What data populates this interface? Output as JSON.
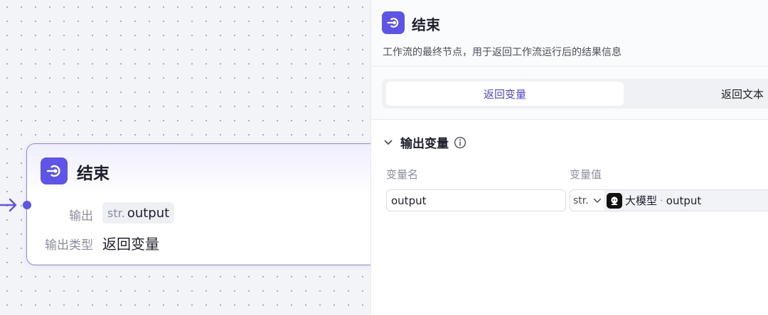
{
  "node": {
    "title": "结束",
    "output_label": "输出",
    "output_type_prefix": "str.",
    "output_name": "output",
    "output_type_label": "输出类型",
    "output_type_value": "返回变量"
  },
  "panel": {
    "title": "结束",
    "description": "工作流的最终节点，用于返回工作流运行后的结果信息",
    "tabs": [
      {
        "label": "返回变量",
        "active": true
      },
      {
        "label": "返回文本",
        "active": false
      }
    ],
    "section_title": "输出变量",
    "columns": {
      "name": "变量名",
      "value": "变量值"
    },
    "row": {
      "name_value": "output",
      "type": "str.",
      "ref_source": "大模型",
      "ref_separator": "·",
      "ref_variable": "output"
    }
  },
  "colors": {
    "accent": "#5e55e8",
    "node_border": "#8b84f0",
    "active_tab_text": "#4d47d6"
  }
}
